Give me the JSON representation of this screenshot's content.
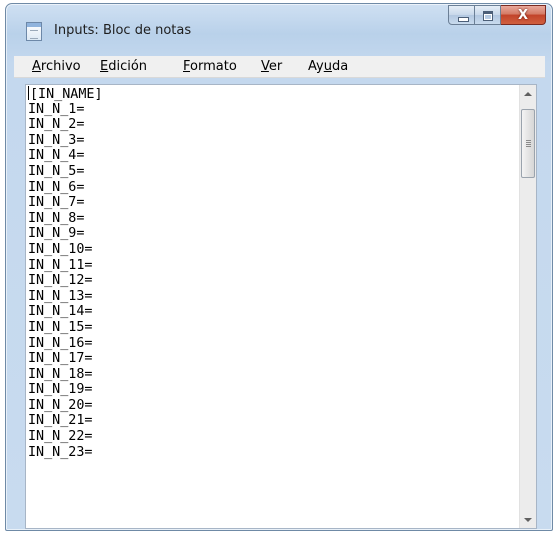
{
  "window": {
    "title": "Inputs: Bloc de notas",
    "icon": "notepad-icon"
  },
  "caption_buttons": {
    "minimize_icon": "minimize-icon",
    "maximize_icon": "maximize-icon",
    "close_glyph": "X"
  },
  "menu": {
    "items": [
      {
        "accel": "A",
        "rest": "rchivo"
      },
      {
        "accel": "E",
        "rest": "dición"
      },
      {
        "accel": "F",
        "rest": "ormato"
      },
      {
        "accel": "V",
        "rest": "er"
      },
      {
        "before": "Ay",
        "accel": "u",
        "rest": "da"
      }
    ]
  },
  "editor": {
    "lines": [
      "[IN_NAME]",
      "IN_N_1=",
      "IN_N_2=",
      "IN_N_3=",
      "IN_N_4=",
      "IN_N_5=",
      "IN_N_6=",
      "IN_N_7=",
      "IN_N_8=",
      "IN_N_9=",
      "IN_N_10=",
      "IN_N_11=",
      "IN_N_12=",
      "IN_N_13=",
      "IN_N_14=",
      "IN_N_15=",
      "IN_N_16=",
      "IN_N_17=",
      "IN_N_18=",
      "IN_N_19=",
      "IN_N_20=",
      "IN_N_21=",
      "IN_N_22=",
      "IN_N_23="
    ]
  },
  "colors": {
    "title_bar": "#b9d1ea",
    "close_button": "#c2432a",
    "menu_bar": "#f0f0f0",
    "editor_bg": "#ffffff"
  }
}
